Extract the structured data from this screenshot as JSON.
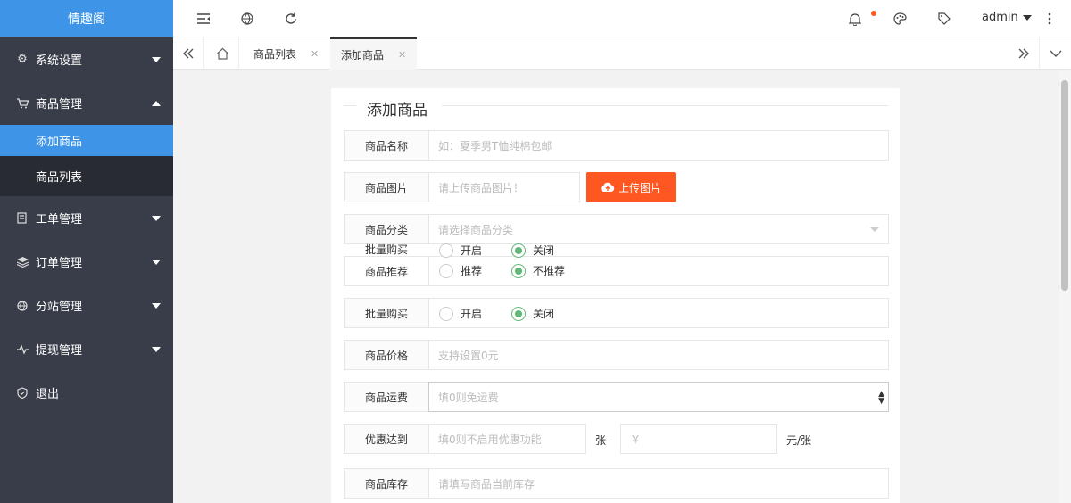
{
  "app": {
    "logo": "情趣阁"
  },
  "sidebar": {
    "items": [
      {
        "label": "系统设置",
        "icon": "gear-icon"
      },
      {
        "label": "商品管理",
        "icon": "cart-icon"
      },
      {
        "label": "工单管理",
        "icon": "ticket-icon"
      },
      {
        "label": "订单管理",
        "icon": "order-icon"
      },
      {
        "label": "分站管理",
        "icon": "globe-icon"
      },
      {
        "label": "提现管理",
        "icon": "pulse-icon"
      },
      {
        "label": "退出",
        "icon": "shield-icon"
      }
    ],
    "submenu": [
      {
        "label": "添加商品",
        "active": true
      },
      {
        "label": "商品列表",
        "active": false
      }
    ]
  },
  "header": {
    "user": "admin",
    "notification_color": "#ff5722"
  },
  "tabs": [
    {
      "label": "商品列表"
    },
    {
      "label": "添加商品"
    }
  ],
  "form": {
    "title": "添加商品",
    "name": {
      "label": "商品名称",
      "placeholder": "如：夏季男T恤纯棉包邮"
    },
    "image": {
      "label": "商品图片",
      "placeholder": "请上传商品图片！",
      "button": "上传图片"
    },
    "category": {
      "label": "商品分类",
      "placeholder": "请选择商品分类"
    },
    "overlay": {
      "bulk_label": "批量购买",
      "recommend_label": "商品推荐",
      "bulk_on": "开启",
      "bulk_off": "关闭",
      "rec_on": "推荐",
      "rec_off": "不推荐"
    },
    "bulk": {
      "label": "批量购买",
      "on": "开启",
      "off": "关闭"
    },
    "price": {
      "label": "商品价格",
      "placeholder": "支持设置0元"
    },
    "shipping": {
      "label": "商品运费",
      "placeholder": "填0则免运费"
    },
    "discount": {
      "label": "优惠达到",
      "placeholder": "填0则不启用优惠功能",
      "unit1": "张 -",
      "currency_placeholder": "￥",
      "unit2": "元/张"
    },
    "stock": {
      "label": "商品库存",
      "placeholder": "请填写商品当前库存"
    }
  },
  "colors": {
    "accent": "#3e95e8",
    "sidebar": "#393d49",
    "danger": "#ff5722",
    "radio": "#5fb878"
  }
}
